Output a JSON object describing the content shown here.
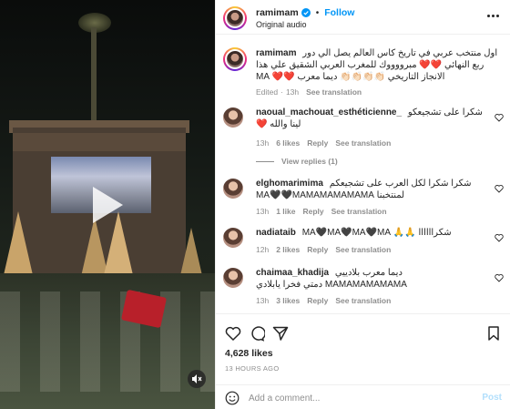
{
  "header": {
    "username": "ramimam",
    "follow_label": "Follow",
    "subtitle": "Original audio",
    "separator": "•"
  },
  "caption": {
    "username": "ramimam",
    "text": "اول منتخب عربي في تاريخ كاس العالم يصل الي دور ربع النهائي ❤️❤️ مبرووووك للمغرب العربي الشقيق علي هذا الانجاز التاريخي 👏🏻👏🏻👏🏻👏🏻 ديما معرب ❤️❤️ MA",
    "meta": [
      "Edited",
      "·",
      "13h",
      "See translation"
    ]
  },
  "comments": [
    {
      "username": "naoual_machouat_esthéticienne_",
      "text": "شكرا على تشجيعكو لينا والله ❤️",
      "time": "13h",
      "likes": "6 likes",
      "reply": "Reply",
      "translate": "See translation"
    },
    {
      "username": "elghomarimima",
      "text": "شكرا شكرا لكل العرب على تشجيعكم لمنتخبنا MA🖤🖤MAMAMAMAMAMA",
      "time": "13h",
      "likes": "1 like",
      "reply": "Reply",
      "translate": "See translation"
    },
    {
      "username": "nadiataib",
      "text": "شكراااااا 🙏🙏 MA🖤MA🖤MA🖤MA",
      "time": "12h",
      "likes": "2 likes",
      "reply": "Reply",
      "translate": "See translation"
    },
    {
      "username": "chaimaa_khadija",
      "text": "ديما معرب بلادييي MAMAMAMAMAMA دمتي فخرا يابلادي",
      "time": "13h",
      "likes": "3 likes",
      "reply": "Reply",
      "translate": "See translation"
    }
  ],
  "view_replies": "View replies (1)",
  "likes_count": "4,628 likes",
  "post_time": "13 HOURS AGO",
  "add_comment": {
    "placeholder": "Add a comment...",
    "post_label": "Post"
  },
  "colors": {
    "accent": "#0095f6",
    "heart": "#ed4956",
    "muted": "#8e8e8e"
  }
}
